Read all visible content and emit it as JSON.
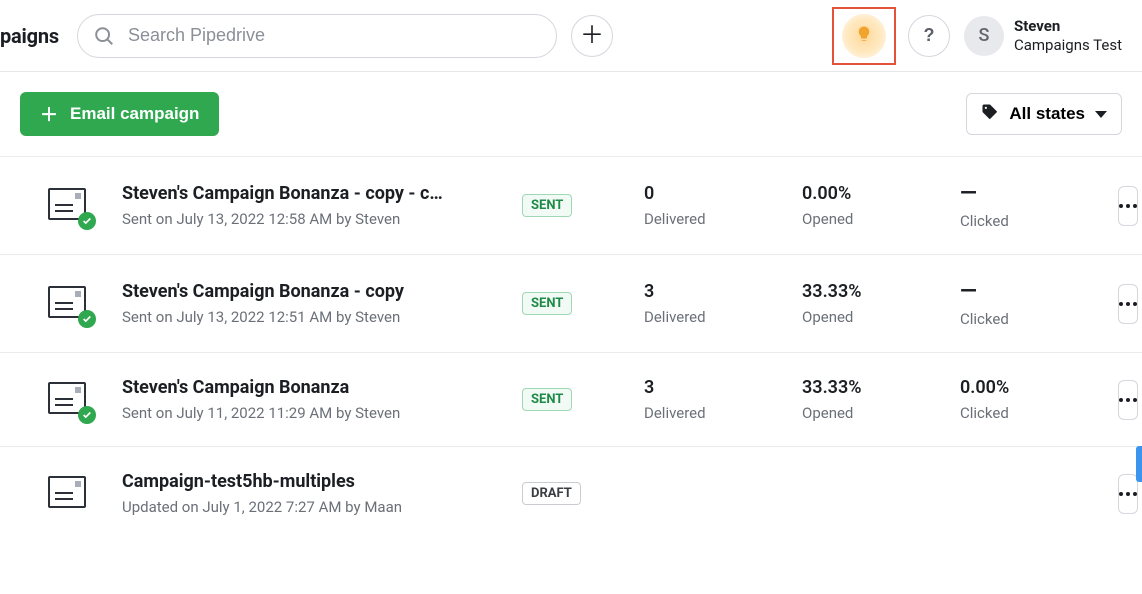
{
  "header": {
    "page_title": "paigns",
    "search_placeholder": "Search Pipedrive",
    "user_name": "Steven",
    "user_sub": "Campaigns Test",
    "avatar_initial": "S"
  },
  "toolbar": {
    "new_campaign_label": "Email campaign",
    "filter_label": "All states"
  },
  "labels": {
    "delivered": "Delivered",
    "opened": "Opened",
    "clicked": "Clicked",
    "dash": "—"
  },
  "campaigns": [
    {
      "title": "Steven's Campaign Bonanza - copy - c…",
      "subtitle": "Sent on July 13, 2022 12:58 AM by Steven",
      "status": "SENT",
      "delivered": "0",
      "opened": "0.00%",
      "clicked": "—"
    },
    {
      "title": "Steven's Campaign Bonanza - copy",
      "subtitle": "Sent on July 13, 2022 12:51 AM by Steven",
      "status": "SENT",
      "delivered": "3",
      "opened": "33.33%",
      "clicked": "—"
    },
    {
      "title": "Steven's Campaign Bonanza",
      "subtitle": "Sent on July 11, 2022 11:29 AM by Steven",
      "status": "SENT",
      "delivered": "3",
      "opened": "33.33%",
      "clicked": "0.00%"
    },
    {
      "title": "Campaign-test5hb-multiples",
      "subtitle": "Updated on July 1, 2022 7:27 AM by Maan",
      "status": "DRAFT",
      "delivered": "",
      "opened": "",
      "clicked": ""
    }
  ]
}
